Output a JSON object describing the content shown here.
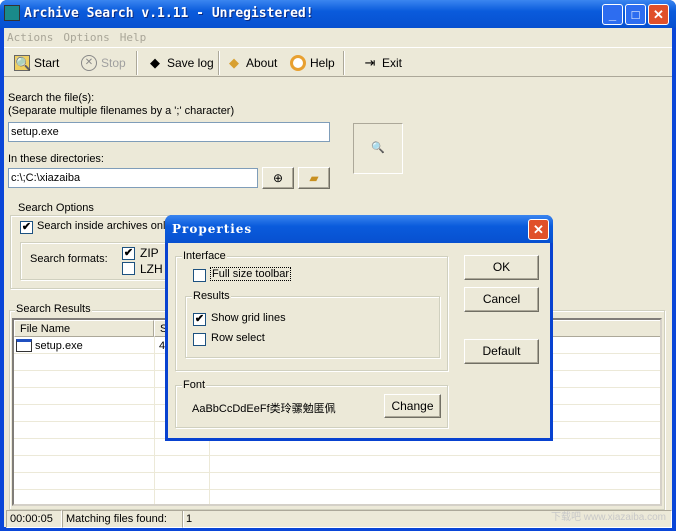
{
  "window": {
    "title": "Archive Search v.1.11 - Unregistered!",
    "minimize": "_",
    "maximize": "□",
    "close": "✕"
  },
  "menu": [
    "Actions",
    "Options",
    "Help"
  ],
  "toolbar": [
    {
      "label": "Start",
      "icon": "search-icon",
      "enabled": true
    },
    {
      "label": "Stop",
      "icon": "stop-icon",
      "enabled": false
    },
    {
      "label": "Save log",
      "icon": "save-log-icon",
      "enabled": true
    },
    {
      "label": "About",
      "icon": "book-icon",
      "enabled": true
    },
    {
      "label": "Help",
      "icon": "lifebuoy-icon",
      "enabled": true
    },
    {
      "label": "Exit",
      "icon": "exit-door-icon",
      "enabled": true
    }
  ],
  "search": {
    "label1": "Search the file(s):",
    "label2": "(Separate multiple filenames by a ';' character)",
    "value": "setup.exe",
    "dir_label": "In these directories:",
    "dir_value": "c:\\;C:\\xiazaiba"
  },
  "options": {
    "title": "Search Options",
    "archives_only": "Search inside archives only",
    "archives_only_checked": true,
    "formats_label": "Search formats:",
    "formats": [
      {
        "label": "ZIP",
        "checked": true
      },
      {
        "label": "LZH",
        "checked": false
      }
    ]
  },
  "results": {
    "title": "Search Results",
    "columns": [
      "File Name",
      "S"
    ],
    "rows": [
      {
        "name": "setup.exe",
        "size": "41"
      }
    ]
  },
  "status": {
    "time": "00:00:05",
    "label": "Matching files found:",
    "count": "1"
  },
  "dialog": {
    "title": "Properties",
    "interface_title": "Interface",
    "full_size_toolbar": "Full size toolbar",
    "full_size_checked": false,
    "results_title": "Results",
    "show_grid_lines": "Show grid lines",
    "show_grid_checked": true,
    "row_select": "Row select",
    "row_select_checked": false,
    "font_title": "Font",
    "font_sample": "AaBbCcDdEeFf类玲骡勉匿佩",
    "change": "Change",
    "ok": "OK",
    "cancel": "Cancel",
    "default": "Default"
  },
  "watermark": "下载吧 www.xiazaiba.com"
}
